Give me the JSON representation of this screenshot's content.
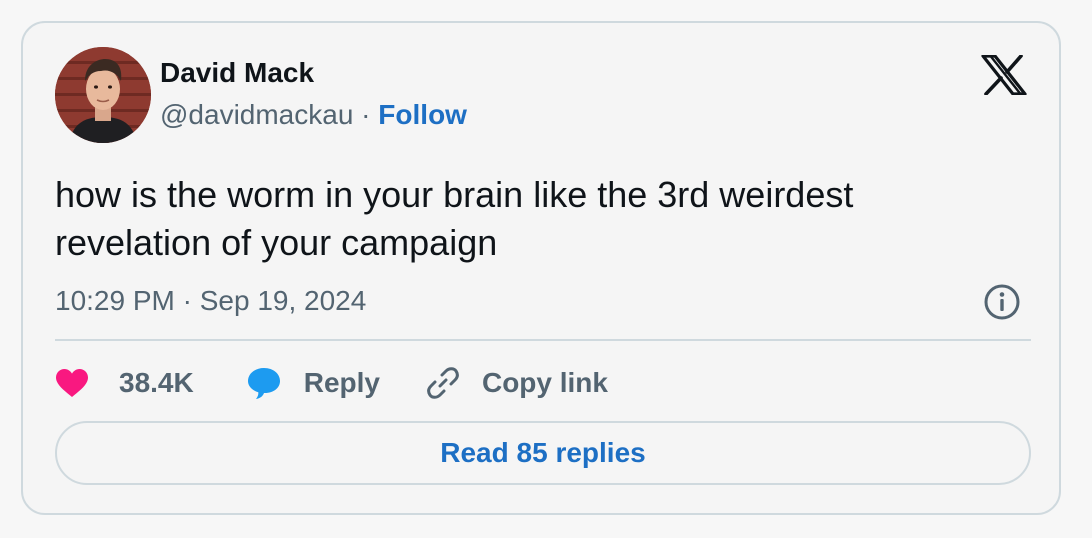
{
  "author": {
    "name": "David Mack",
    "handle": "@davidmackau",
    "separator": " · ",
    "follow_label": "Follow"
  },
  "tweet": {
    "text": "how is the worm in your brain like the 3rd weirdest revelation of your campaign",
    "timestamp": "10:29 PM · Sep 19, 2024"
  },
  "actions": {
    "like_count": "38.4K",
    "reply_label": "Reply",
    "copy_link_label": "Copy link"
  },
  "read_replies_label": "Read 85 replies",
  "icons": {
    "platform_logo": "x-logo-icon",
    "info": "info-icon",
    "like": "heart-icon",
    "reply": "speech-bubble-icon",
    "copy": "link-icon"
  },
  "colors": {
    "like": "#f91880",
    "reply": "#1d9bf0",
    "link_blue": "#1d6fc4",
    "secondary_text": "#536471",
    "primary_text": "#0f1419",
    "border": "#cfd9de"
  }
}
